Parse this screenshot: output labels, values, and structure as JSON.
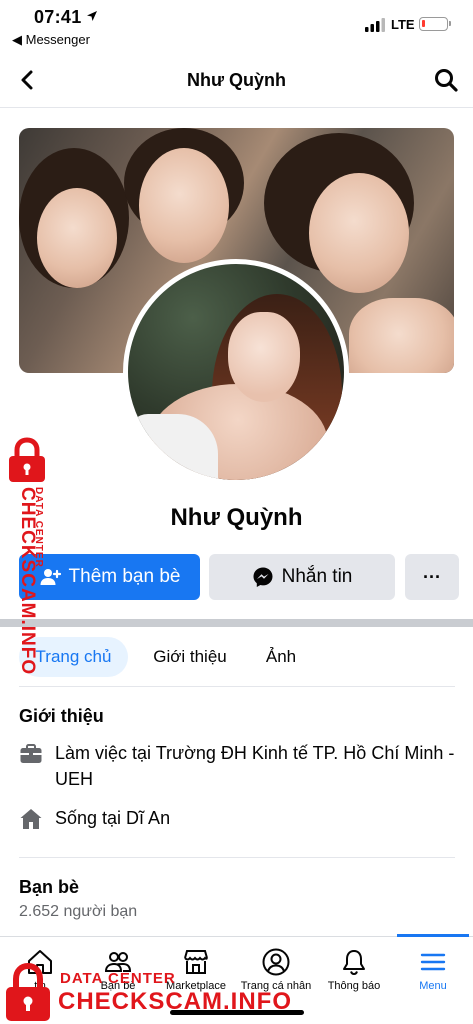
{
  "status_bar": {
    "time": "07:41",
    "back_app": "◀ Messenger",
    "network": "LTE"
  },
  "header": {
    "title": "Như Quỳnh"
  },
  "profile": {
    "name": "Như Quỳnh",
    "buttons": {
      "add_friend": "Thêm bạn bè",
      "message": "Nhắn tin",
      "more": "···"
    }
  },
  "tabs": [
    {
      "label": "Trang chủ",
      "active": true
    },
    {
      "label": "Giới thiệu",
      "active": false
    },
    {
      "label": "Ảnh",
      "active": false
    }
  ],
  "intro": {
    "title": "Giới thiệu",
    "items": [
      {
        "icon": "briefcase-icon",
        "text": "Làm việc tại Trường ĐH Kinh tế TP. Hồ Chí Minh - UEH"
      },
      {
        "icon": "house-icon",
        "text": "Sống tại Dĩ An"
      }
    ]
  },
  "friends": {
    "title": "Bạn bè",
    "count": "2.652 người bạn"
  },
  "tabbar": {
    "items": [
      {
        "label": "tin",
        "icon": "home-icon"
      },
      {
        "label": "Bạn bè",
        "icon": "friends-icon"
      },
      {
        "label": "Marketplace",
        "icon": "marketplace-icon"
      },
      {
        "label": "Trang cá nhân",
        "icon": "profile-icon"
      },
      {
        "label": "Thông báo",
        "icon": "bell-icon"
      },
      {
        "label": "Menu",
        "icon": "menu-icon",
        "active": true
      }
    ]
  },
  "watermark": {
    "main": "CHECKSCAM.INFO",
    "sub": "DATA CENTER",
    "color": "#e0161b"
  },
  "colors": {
    "accent": "#1877f2",
    "button_gray": "#e4e6eb",
    "tab_active_bg": "#e7f3ff",
    "secondary_text": "#65676b"
  }
}
